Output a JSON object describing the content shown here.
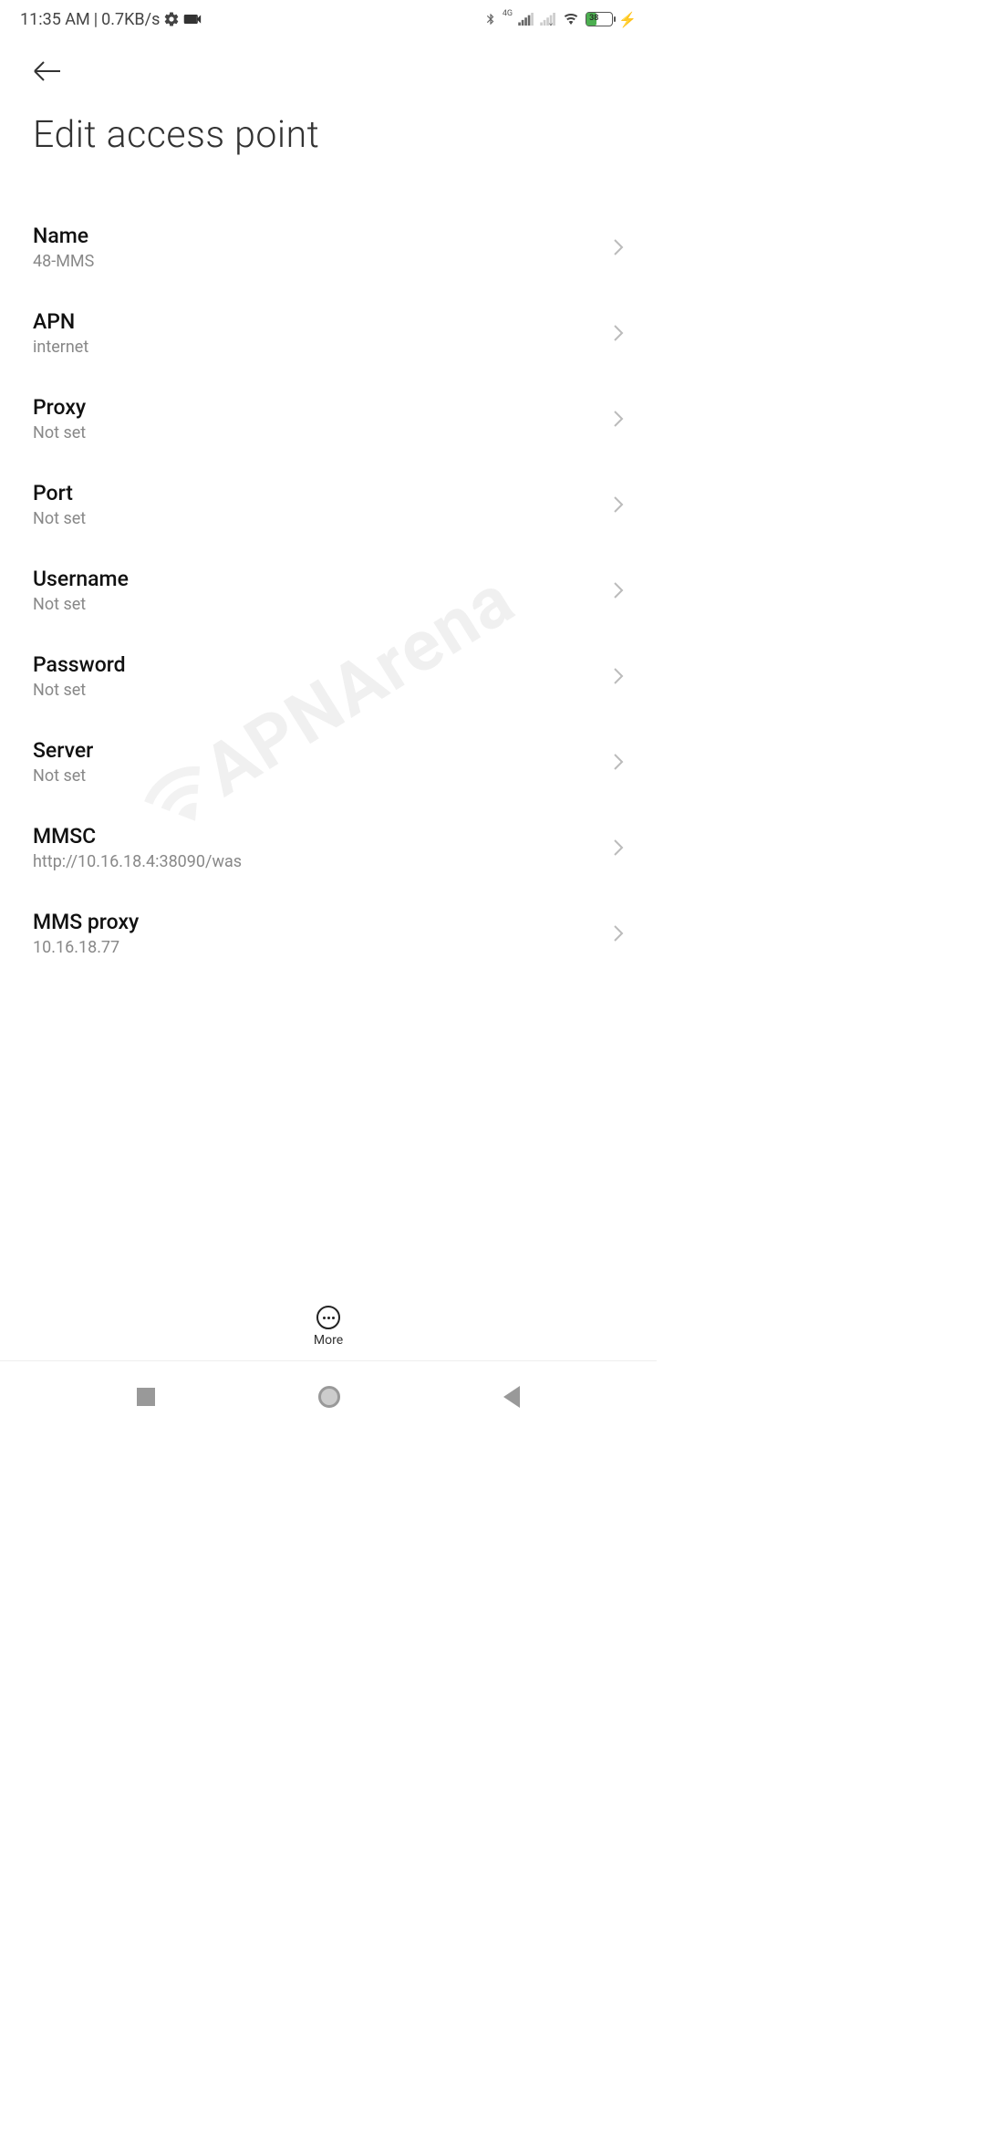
{
  "status": {
    "time": "11:35 AM",
    "separator": "|",
    "data_rate": "0.7KB/s",
    "network_label": "4G",
    "battery_percent": "38"
  },
  "page": {
    "title": "Edit access point"
  },
  "rows": [
    {
      "label": "Name",
      "value": "48-MMS"
    },
    {
      "label": "APN",
      "value": "internet"
    },
    {
      "label": "Proxy",
      "value": "Not set"
    },
    {
      "label": "Port",
      "value": "Not set"
    },
    {
      "label": "Username",
      "value": "Not set"
    },
    {
      "label": "Password",
      "value": "Not set"
    },
    {
      "label": "Server",
      "value": "Not set"
    },
    {
      "label": "MMSC",
      "value": "http://10.16.18.4:38090/was"
    },
    {
      "label": "MMS proxy",
      "value": "10.16.18.77"
    }
  ],
  "actions": {
    "more_label": "More"
  },
  "watermark": "APNArena"
}
